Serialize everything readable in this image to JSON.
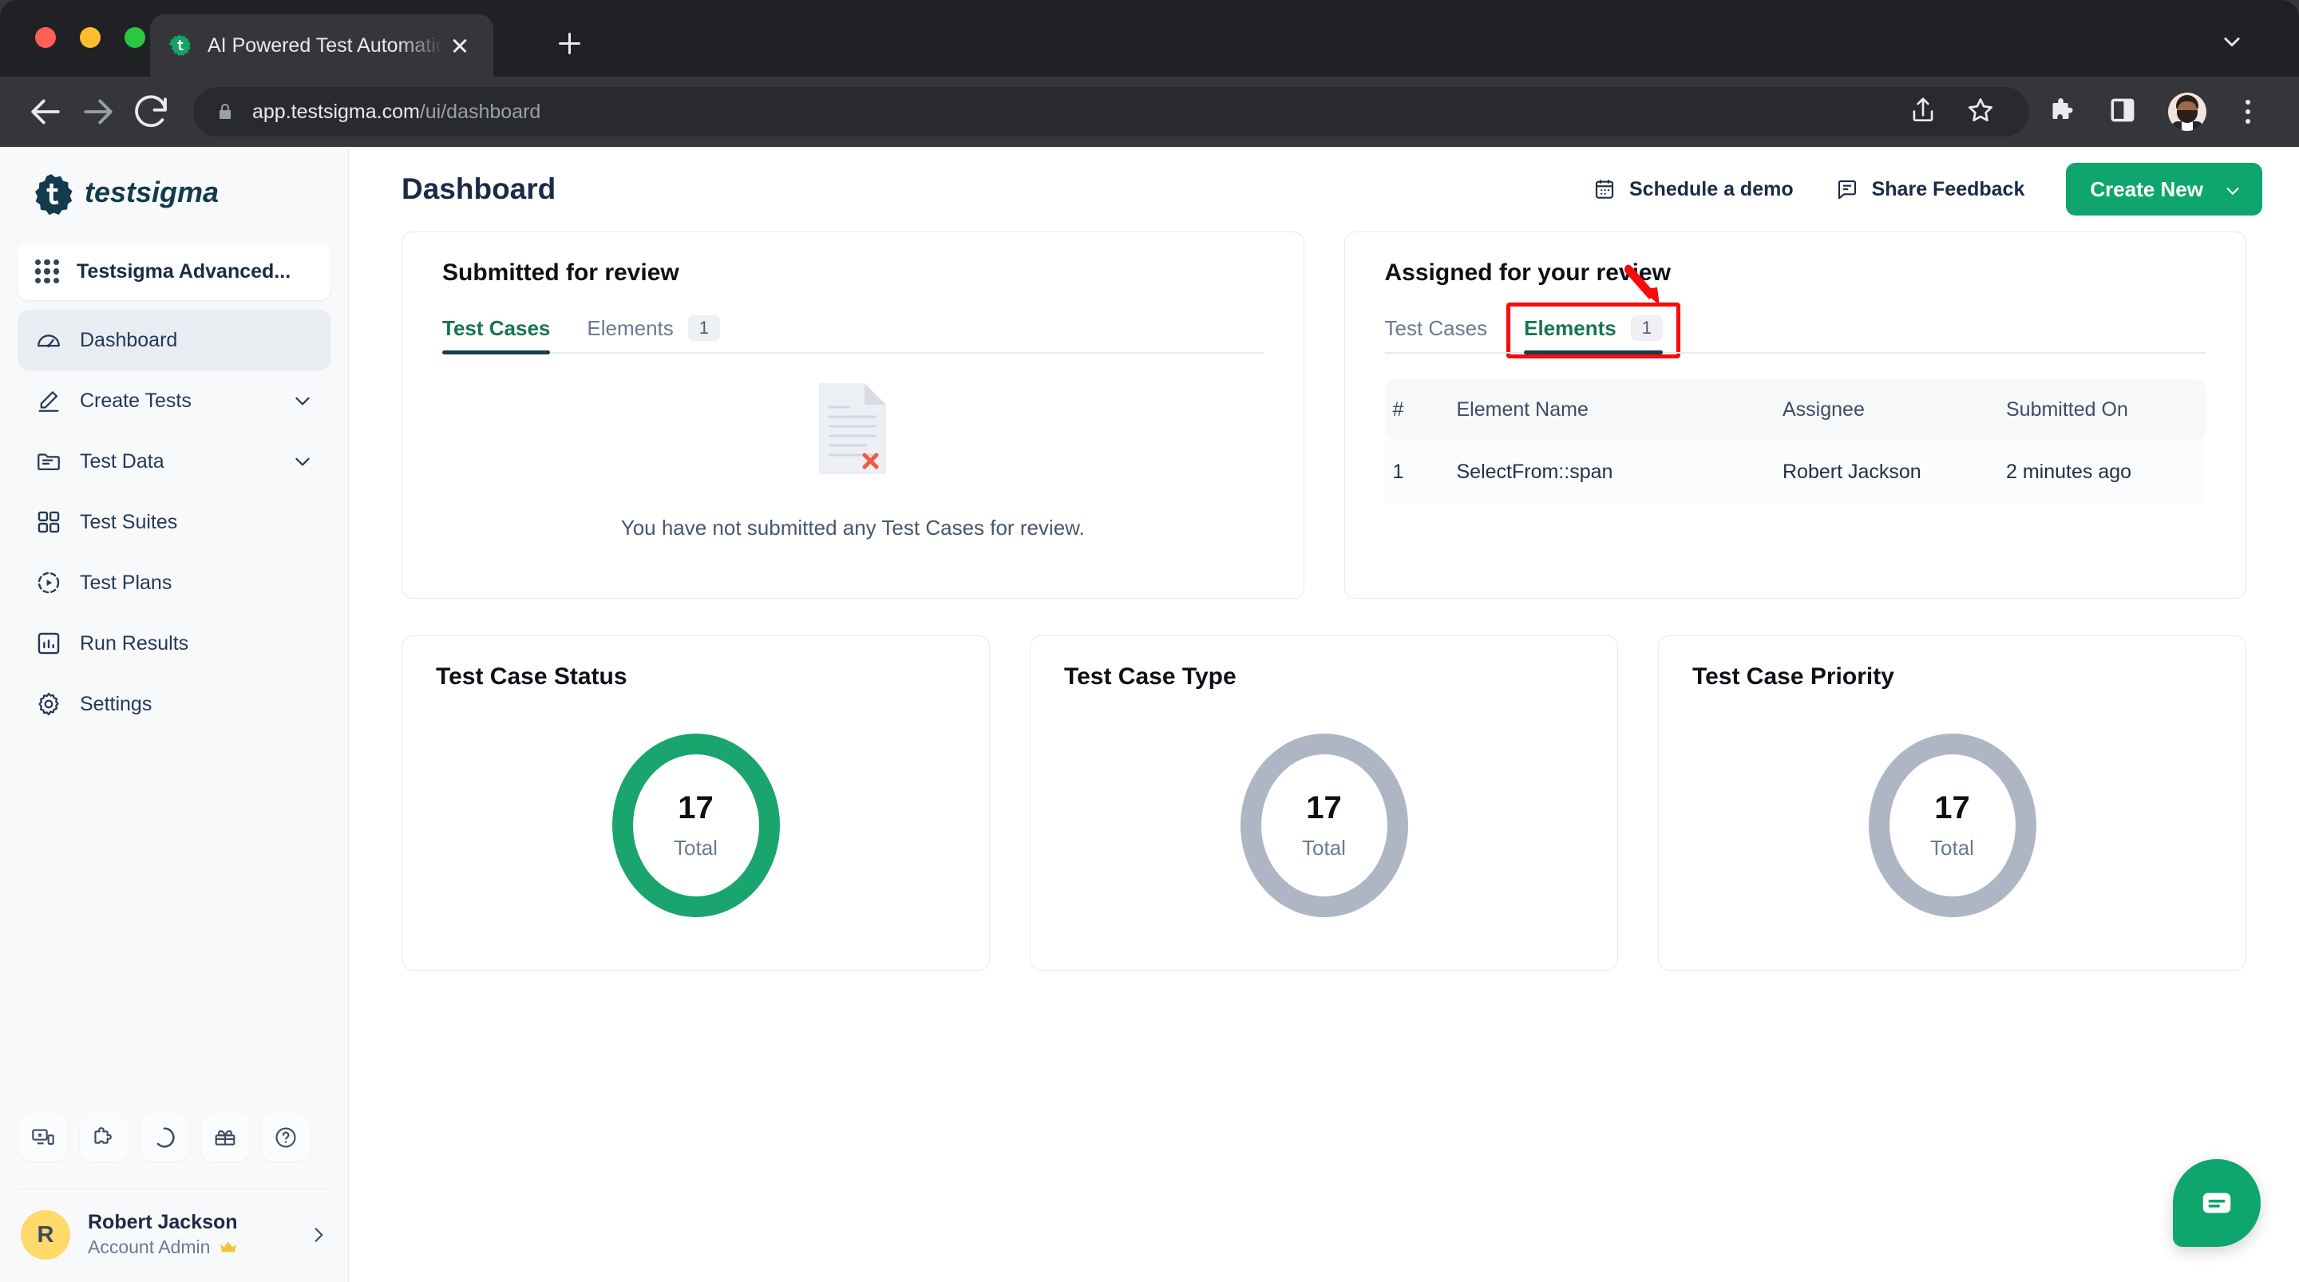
{
  "browser": {
    "tab_title": "AI Powered Test Automation Pl",
    "url_host": "app.testsigma.com",
    "url_path": "/ui/dashboard",
    "icons": {
      "back": "back-arrow-icon",
      "forward": "forward-arrow-icon",
      "reload": "reload-icon",
      "lock": "lock-icon",
      "share": "share-icon",
      "bookmark": "star-icon",
      "extensions": "puzzle-icon",
      "side_panel": "side-panel-icon",
      "profile": "profile-avatar-icon",
      "menu": "kebab-menu-icon",
      "new_tab": "plus-icon",
      "tab_close": "close-icon",
      "tab_list": "chevron-down-icon"
    }
  },
  "sidebar": {
    "logo_text": "testsigma",
    "project": {
      "name": "Testsigma Advanced...",
      "icon": "grid-dots-icon"
    },
    "items": [
      {
        "label": "Dashboard",
        "icon": "speedometer-icon",
        "active": true,
        "expandable": false
      },
      {
        "label": "Create Tests",
        "icon": "pencil-icon",
        "active": false,
        "expandable": true
      },
      {
        "label": "Test Data",
        "icon": "folder-icon",
        "active": false,
        "expandable": true
      },
      {
        "label": "Test Suites",
        "icon": "grid-squares-icon",
        "active": false,
        "expandable": false
      },
      {
        "label": "Test Plans",
        "icon": "play-circle-icon",
        "active": false,
        "expandable": false
      },
      {
        "label": "Run Results",
        "icon": "bar-chart-icon",
        "active": false,
        "expandable": false
      },
      {
        "label": "Settings",
        "icon": "gear-icon",
        "active": false,
        "expandable": false
      }
    ],
    "tools": [
      {
        "icon": "devices-icon"
      },
      {
        "icon": "puzzle-icon"
      },
      {
        "icon": "progress-circle-icon"
      },
      {
        "icon": "gift-icon"
      },
      {
        "icon": "help-circle-icon"
      }
    ],
    "user": {
      "initial": "R",
      "name": "Robert Jackson",
      "role": "Account Admin",
      "badge_icon": "crown-icon",
      "chevron": "chevron-right-icon"
    }
  },
  "header": {
    "title": "Dashboard",
    "schedule_demo": {
      "label": "Schedule a demo",
      "icon": "calendar-icon"
    },
    "share_feedback": {
      "label": "Share Feedback",
      "icon": "feedback-icon"
    },
    "create_new": {
      "label": "Create New",
      "icon": "chevron-down-icon"
    }
  },
  "submitted_card": {
    "title": "Submitted for review",
    "tabs": [
      {
        "label": "Test Cases",
        "badge": "",
        "selected": true
      },
      {
        "label": "Elements",
        "badge": "1",
        "selected": false
      }
    ],
    "empty_text": "You have not submitted any Test Cases for review.",
    "empty_icon": "document-error-icon"
  },
  "assigned_card": {
    "title": "Assigned for your review",
    "tabs": [
      {
        "label": "Test Cases",
        "badge": "",
        "selected": false
      },
      {
        "label": "Elements",
        "badge": "1",
        "selected": true,
        "highlighted": true
      }
    ],
    "table": {
      "columns": [
        "#",
        "Element Name",
        "Assignee",
        "Submitted On"
      ],
      "rows": [
        {
          "num": "1",
          "name": "SelectFrom::span",
          "assignee": "Robert Jackson",
          "submitted": "2 minutes ago"
        }
      ]
    }
  },
  "stat_cards": [
    {
      "title": "Test Case Status",
      "value": "17",
      "label": "Total",
      "color": "#1aa46e"
    },
    {
      "title": "Test Case Type",
      "value": "17",
      "label": "Total",
      "color": "#aeb5c4"
    },
    {
      "title": "Test Case Priority",
      "value": "17",
      "label": "Total",
      "color": "#aeb5c4"
    }
  ],
  "annotations": {
    "arrow": "red-arrow-icon",
    "highlight_color": "#fa0a0a"
  },
  "chat": {
    "icon": "chat-bubble-icon"
  },
  "colors": {
    "brand_green": "#0ea56e",
    "tab_active_green": "#16754f",
    "navy": "#1b2a47",
    "sidebar_bg": "#f8f9fb"
  }
}
